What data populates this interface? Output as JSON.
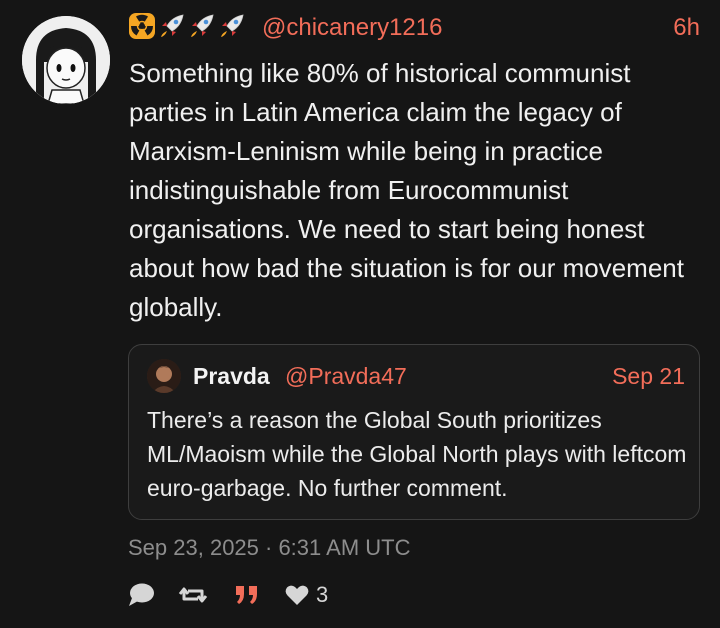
{
  "post": {
    "emojis": [
      "radioactive-badge-icon",
      "rocket-icon",
      "rocket-icon",
      "rocket-icon"
    ],
    "handle": "@chicanery1216",
    "time": "6h",
    "text": "Something like 80% of historical communist parties in Latin America claim the legacy of Marxism-Leninism while being in practice indistinguishable from Eurocommunist organisations. We need to start being honest about how bad the situation is for our movement globally.",
    "timestamp": "Sep 23, 2025 · 6:31 AM UTC"
  },
  "quote": {
    "name": "Pravda",
    "handle": "@Pravda47",
    "date": "Sep 21",
    "text": "There’s a reason the Global South prioritizes ML/Maoism while the Global North plays with leftcom euro-garbage. No further comment."
  },
  "actions": {
    "reply_icon": "speech-bubble-icon",
    "repost_icon": "repost-icon",
    "quote_icon": "quote-marks-icon",
    "like_icon": "heart-icon",
    "like_count": "3"
  },
  "colors": {
    "background": "#151515",
    "accent": "#f26d59",
    "text": "#f0f0f0",
    "muted": "#8d8d8d"
  }
}
